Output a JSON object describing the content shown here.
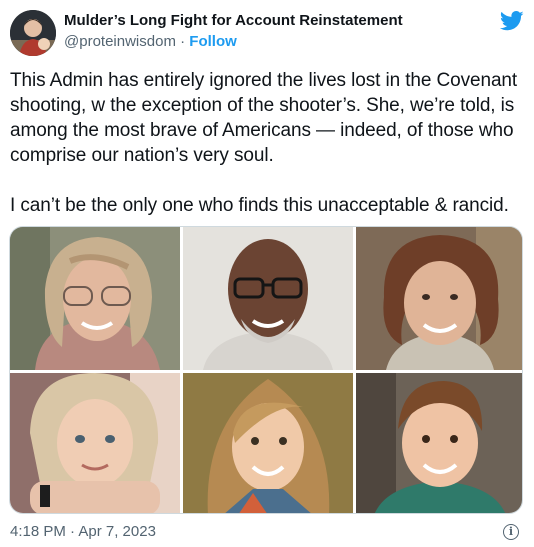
{
  "author": {
    "display_name": "Mulder’s Long Fight for Account Reinstatement",
    "handle": "@proteinwisdom",
    "separator": "·",
    "follow_label": "Follow",
    "avatar_icon": "profile-photo"
  },
  "brand": {
    "icon": "twitter-bird-icon",
    "color": "#1d9bf0"
  },
  "tweet": {
    "paragraphs": [
      "This Admin has entirely ignored the lives lost in the Covenant shooting, w the exception of the shooter’s. She, we’re told, is among the most brave of Americans — indeed, of those who comprise our nation’s very soul.",
      "I can’t be the only one who finds this unacceptable & rancid."
    ]
  },
  "media": {
    "photo_count": 6,
    "photos": [
      {
        "subject": "older woman with glasses"
      },
      {
        "subject": "man with glasses"
      },
      {
        "subject": "woman with short brown hair"
      },
      {
        "subject": "girl with chin on hands"
      },
      {
        "subject": "smiling girl"
      },
      {
        "subject": "smiling boy"
      }
    ]
  },
  "footer": {
    "timestamp": "4:18 PM · Apr 7, 2023",
    "info_icon": "info-icon",
    "info_glyph": "i"
  }
}
